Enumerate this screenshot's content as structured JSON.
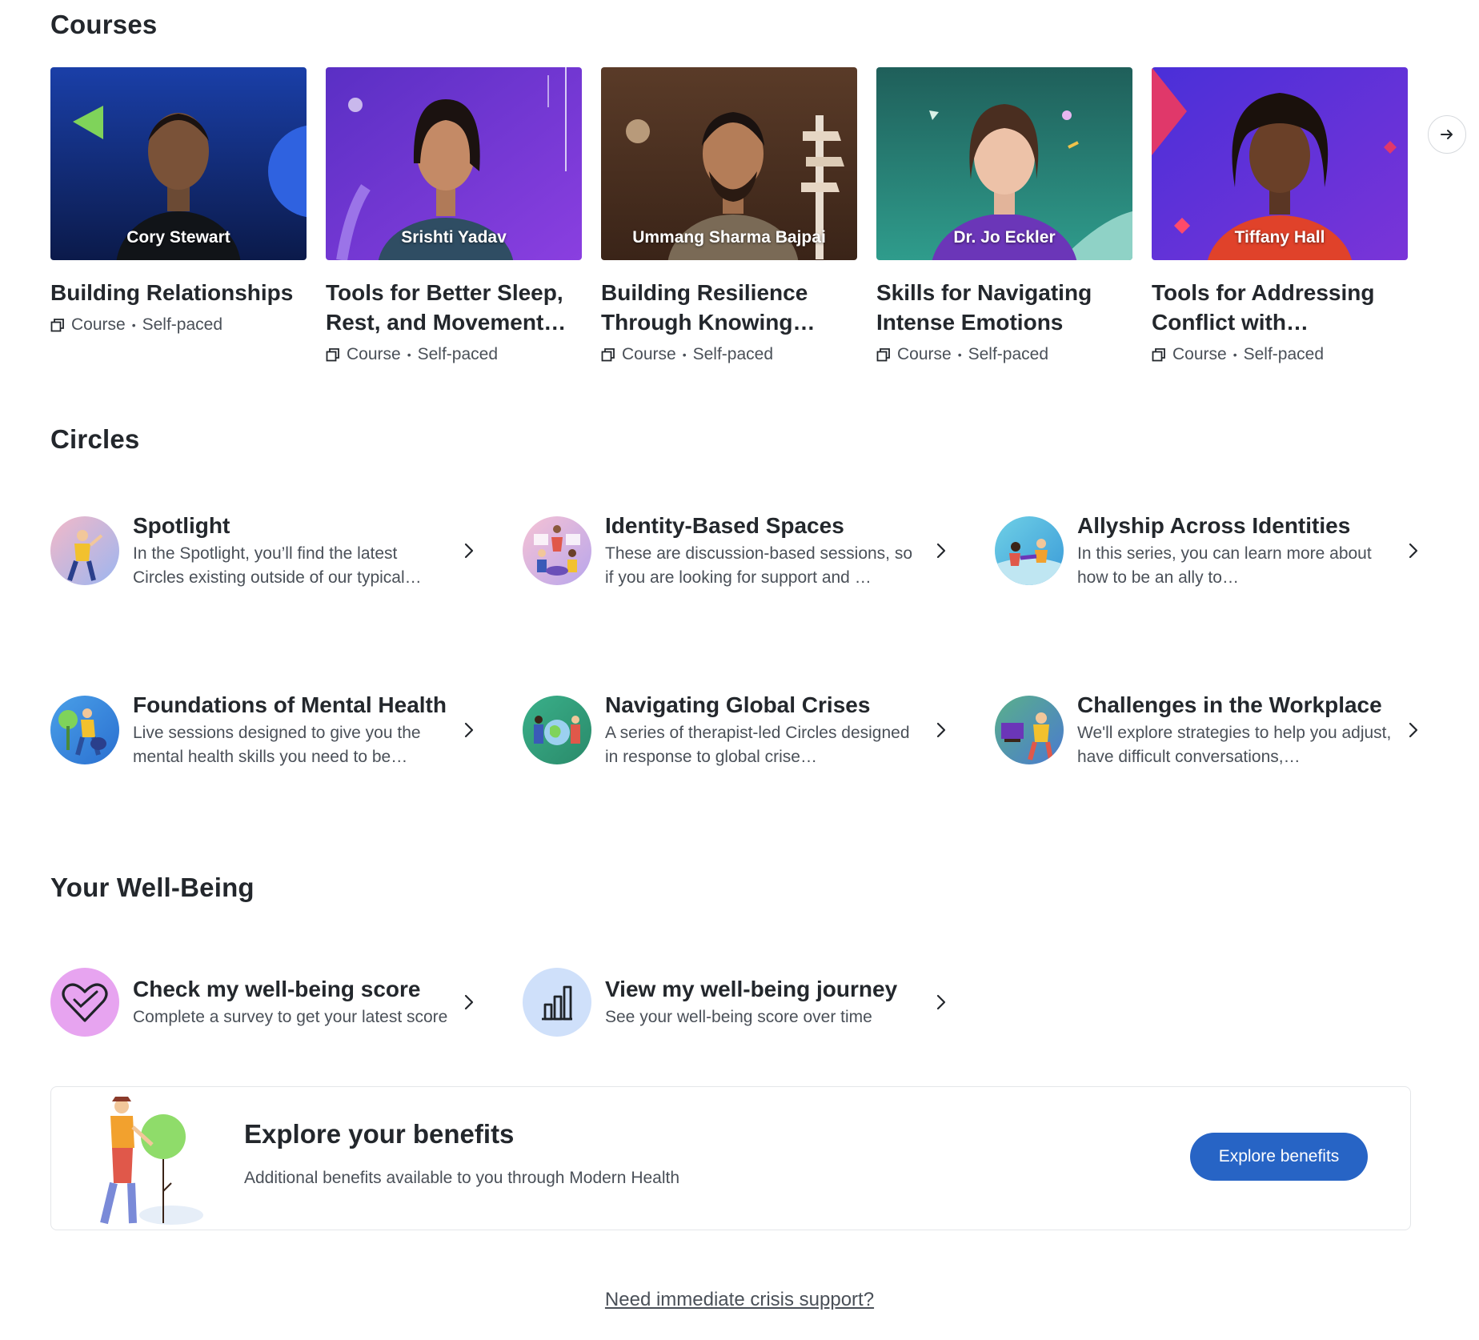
{
  "courses": {
    "title": "Courses",
    "items": [
      {
        "name": "Cory Stewart",
        "title": "Building Relationships",
        "type": "Course",
        "pace": "Self-paced"
      },
      {
        "name": "Srishti Yadav",
        "title": "Tools for Better Sleep, Rest, and Movement…",
        "type": "Course",
        "pace": "Self-paced"
      },
      {
        "name": "Ummang Sharma Bajpai",
        "title": "Building Resilience Through Knowing…",
        "type": "Course",
        "pace": "Self-paced"
      },
      {
        "name": "Dr. Jo Eckler",
        "title": "Skills for Navigating Intense Emotions",
        "type": "Course",
        "pace": "Self-paced"
      },
      {
        "name": "Tiffany Hall",
        "title": "Tools for Addressing Conflict with…",
        "type": "Course",
        "pace": "Self-paced"
      }
    ]
  },
  "circles": {
    "title": "Circles",
    "items": [
      {
        "title": "Spotlight",
        "desc": "In the Spotlight, you’ll find the latest Circles existing outside of our typical…"
      },
      {
        "title": "Identity-Based Spaces",
        "desc": "These are discussion-based sessions, so if you are looking for support and …"
      },
      {
        "title": "Allyship Across Identities",
        "desc": "In this series, you can learn more about how to be an ally to…"
      },
      {
        "title": "Foundations of Mental Health",
        "desc": "Live sessions designed to give you the mental health skills you need to be…"
      },
      {
        "title": "Navigating Global Crises",
        "desc": "A series of therapist-led Circles designed in response to global crise…"
      },
      {
        "title": "Challenges in the Workplace",
        "desc": "We'll explore strategies to help you adjust, have difficult conversations,…"
      }
    ]
  },
  "wellbeing": {
    "title": "Your Well-Being",
    "items": [
      {
        "title": "Check my well-being score",
        "desc": "Complete a survey to get your latest score"
      },
      {
        "title": "View my well-being journey",
        "desc": "See your well-being score over time"
      }
    ]
  },
  "benefits": {
    "title": "Explore your benefits",
    "desc": "Additional benefits available to you through Modern Health",
    "button": "Explore benefits"
  },
  "crisis": {
    "link": "Need immediate crisis support?"
  },
  "colors": {
    "accent": "#2764c5",
    "heading": "#23272c",
    "muted": "#4a5058"
  }
}
